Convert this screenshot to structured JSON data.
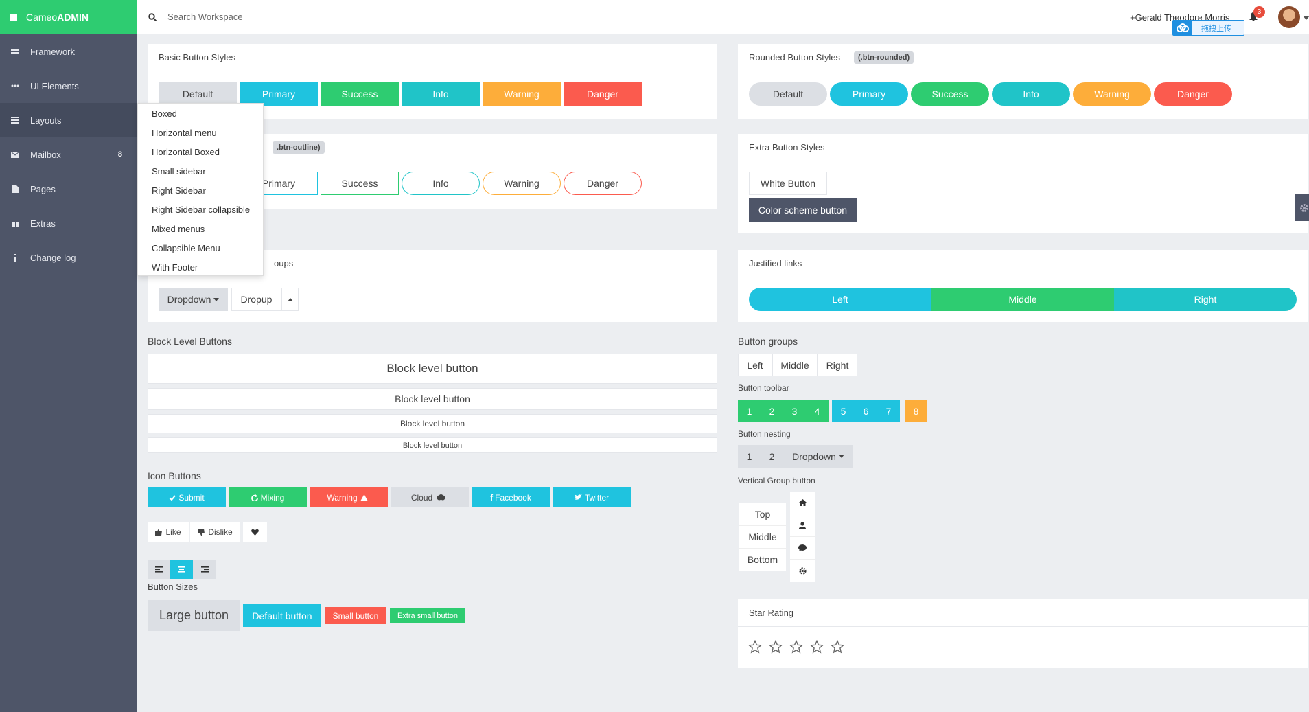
{
  "brand": {
    "prefix": "Cameo",
    "suffix": "ADMIN"
  },
  "sidebar": {
    "items": [
      {
        "label": "Framework",
        "icon": "server-icon"
      },
      {
        "label": "UI Elements",
        "icon": "ellipsis-icon"
      },
      {
        "label": "Layouts",
        "icon": "layers-icon"
      },
      {
        "label": "Mailbox",
        "icon": "envelope-icon",
        "badge": "8"
      },
      {
        "label": "Pages",
        "icon": "file-icon"
      },
      {
        "label": "Extras",
        "icon": "gift-icon"
      },
      {
        "label": "Change log",
        "icon": "info-icon"
      }
    ]
  },
  "topbar": {
    "search_placeholder": "Search Workspace",
    "user": "+Gerald Theodore Morris",
    "notifications": "3",
    "upload_label": "拖拽上传"
  },
  "layout_menu": [
    "Boxed",
    "Horizontal menu",
    "Horizontal Boxed",
    "Small sidebar",
    "Right Sidebar",
    "Right Sidebar collapsible",
    "Mixed menus",
    "Collapsible Menu",
    "With Footer"
  ],
  "basic": {
    "title": "Basic Button Styles",
    "buttons": [
      "Default",
      "Primary",
      "Success",
      "Info",
      "Warning",
      "Danger"
    ]
  },
  "outline": {
    "tag": ".btn-outline)",
    "buttons": [
      "Primary",
      "Success",
      "Info",
      "Warning",
      "Danger"
    ]
  },
  "dropdowns": {
    "title": "oups",
    "dropdown": "Dropdown",
    "dropup": "Dropup"
  },
  "rounded": {
    "title": "Rounded Button Styles",
    "tag": "(.btn-rounded)",
    "buttons": [
      "Default",
      "Primary",
      "Success",
      "Info",
      "Warning",
      "Danger"
    ]
  },
  "extra": {
    "title": "Extra Button Styles",
    "white": "White Button",
    "scheme": "Color scheme button"
  },
  "justified": {
    "title": "Justified links",
    "buttons": [
      "Left",
      "Middle",
      "Right"
    ]
  },
  "block": {
    "title": "Block Level Buttons",
    "buttons": [
      "Block level button",
      "Block level button",
      "Block level button",
      "Block level button"
    ]
  },
  "icon_buttons": {
    "title": "Icon Buttons",
    "submit": "Submit",
    "mixing": "Mixing",
    "warning": "Warning",
    "cloud": "Cloud",
    "facebook": "Facebook",
    "twitter": "Twitter",
    "like": "Like",
    "dislike": "Dislike"
  },
  "sizes": {
    "title": "Button Sizes",
    "large": "Large button",
    "default": "Default button",
    "small": "Small button",
    "xsmall": "Extra small button"
  },
  "groups": {
    "title": "Button groups",
    "buttons": [
      "Left",
      "Middle",
      "Right"
    ],
    "toolbar_title": "Button toolbar",
    "toolbar": [
      "1",
      "2",
      "3",
      "4",
      "5",
      "6",
      "7",
      "8"
    ],
    "nesting_title": "Button nesting",
    "nesting": [
      "1",
      "2",
      "Dropdown"
    ],
    "vertical_title": "Vertical Group button",
    "vertical": [
      "Top",
      "Middle",
      "Bottom"
    ]
  },
  "rating": {
    "title": "Star Rating",
    "value": 0,
    "max": 5
  },
  "colors": {
    "success": "#2ecc71",
    "primary": "#1fc3df",
    "info": "#20c4c8",
    "warning": "#fdad3a",
    "danger": "#fb5b4e",
    "sidebar": "#4e5568"
  }
}
